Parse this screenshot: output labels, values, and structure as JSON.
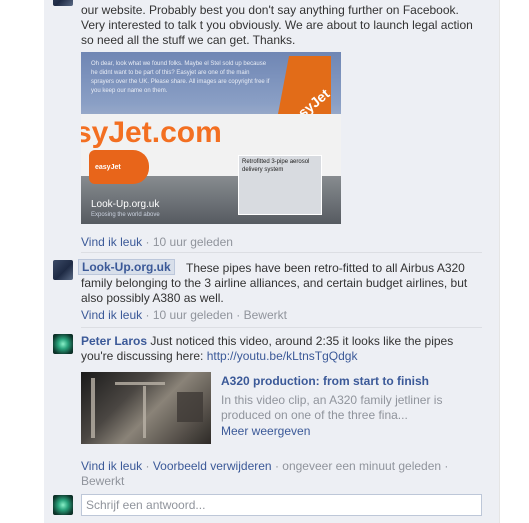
{
  "comments": [
    {
      "text_lines": [
        "our website. Probably best you don't say anything further on Facebook.",
        "Very interested to talk t you obviously. We are about to launch legal action",
        "so need all the stuff we can get. Thanks."
      ],
      "like": "Vind ik leuk",
      "time": "10 uur geleden",
      "photo": {
        "caption": "Oh dear, look what we found folks. Maybe el Stel sold up because he didnt want to be part of this? Easyjet are one of the main sprayers over the UK. Please share. All images are copyright free if you keep our name on them.",
        "tail_text": "easyJet",
        "brand_text": "syJet.com",
        "engine_text": "easyJet",
        "inset_label": "Retrofitted 3-pipe aerosol delivery system",
        "watermark": "Look-Up.org.uk",
        "watermark_sub": "Exposing the world above"
      }
    },
    {
      "author": "Look-Up.org.uk",
      "text_first": "These pipes have been retro-fitted to all Airbus A320",
      "text_lines": [
        "family belonging to the 3 airline alliances, and certain budget airlines, but",
        "also possibly A380 as well."
      ],
      "like": "Vind ik leuk",
      "time": "10 uur geleden",
      "edited": "Bewerkt"
    },
    {
      "author": "Peter Laros",
      "text_first": "Just noticed this video, around 2:35 it looks like the pipes",
      "text_second": "you're discussing here:",
      "url": "http://youtu.be/kLtnsTgQdgk",
      "video": {
        "title": "A320 production: from start to finish",
        "desc_line1": "In this video clip, an A320 family jetliner is",
        "desc_line2": "produced on one of the three fina...",
        "more": "Meer weergeven"
      },
      "like": "Vind ik leuk",
      "remove_preview": "Voorbeeld verwijderen",
      "time": "ongeveer een minuut geleden",
      "edited": "Bewerkt"
    }
  ],
  "reply": {
    "placeholder": "Schrijf een antwoord..."
  },
  "separator": "·"
}
